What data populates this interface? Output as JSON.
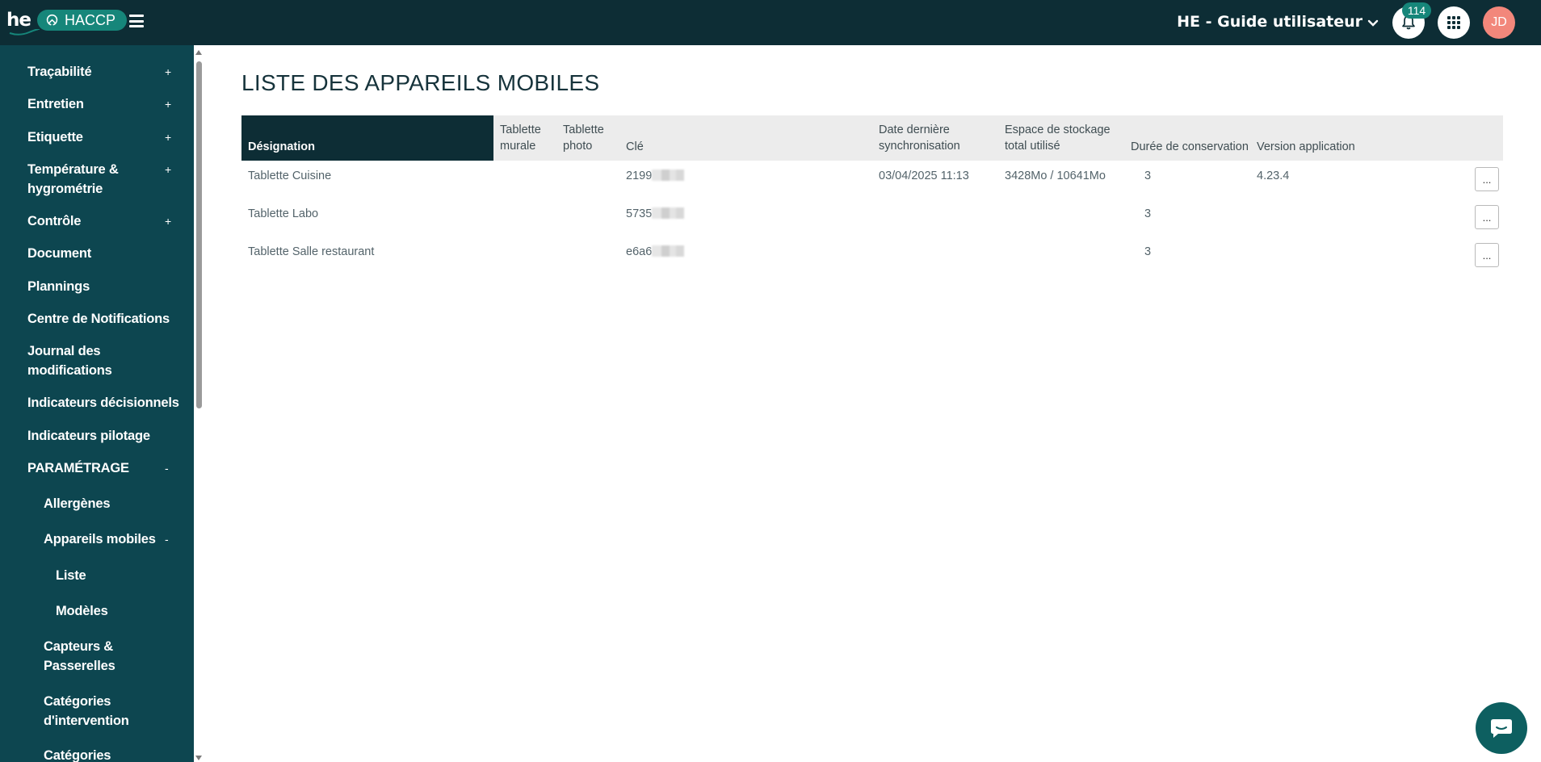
{
  "header": {
    "logo_text": "he",
    "app_name": "HACCP",
    "org_name": "HE - Guide utilisateur",
    "notification_count": "114",
    "avatar_initials": "JD"
  },
  "sidebar": {
    "items": [
      {
        "label": "Traçabilité",
        "toggle": "+",
        "level": 0
      },
      {
        "label": "Entretien",
        "toggle": "+",
        "level": 0
      },
      {
        "label": "Etiquette",
        "toggle": "+",
        "level": 0
      },
      {
        "label": "Température & hygrométrie",
        "toggle": "+",
        "level": 0
      },
      {
        "label": "Contrôle",
        "toggle": "+",
        "level": 0
      },
      {
        "label": "Document",
        "toggle": "",
        "level": 0
      },
      {
        "label": "Plannings",
        "toggle": "",
        "level": 0
      },
      {
        "label": "Centre de Notifications",
        "toggle": "",
        "level": 0
      },
      {
        "label": "Journal des modifications",
        "toggle": "",
        "level": 0
      },
      {
        "label": "Indicateurs décisionnels",
        "toggle": "",
        "level": 0
      },
      {
        "label": "Indicateurs pilotage",
        "toggle": "",
        "level": 0
      },
      {
        "label": "PARAMÉTRAGE",
        "toggle": "-",
        "level": 0
      },
      {
        "label": "Allergènes",
        "toggle": "",
        "level": 1
      },
      {
        "label": "Appareils mobiles",
        "toggle": "-",
        "level": 1
      },
      {
        "label": "Liste",
        "toggle": "",
        "level": 2
      },
      {
        "label": "Modèles",
        "toggle": "",
        "level": 2
      },
      {
        "label": "Capteurs & Passerelles",
        "toggle": "",
        "level": 1
      },
      {
        "label": "Catégories d'intervention",
        "toggle": "",
        "level": 1
      },
      {
        "label": "Catégories",
        "toggle": "",
        "level": 1
      }
    ]
  },
  "main": {
    "title": "LISTE DES APPAREILS MOBILES",
    "columns": {
      "designation": "Désignation",
      "tablette_murale_1": "Tablette",
      "tablette_murale_2": "murale",
      "tablette_photo_1": "Tablette",
      "tablette_photo_2": "photo",
      "cle": "Clé",
      "date_sync_1": "Date dernière",
      "date_sync_2": "synchronisation",
      "stockage_1": "Espace de stockage",
      "stockage_2": "total utilisé",
      "duree": "Durée de conservation",
      "version": "Version application"
    },
    "rows": [
      {
        "designation": "Tablette Cuisine",
        "cle": "2199",
        "date_sync": "03/04/2025 11:13",
        "stockage": "3428Mo / 10641Mo",
        "duree": "3",
        "version": "4.23.4",
        "action": "..."
      },
      {
        "designation": "Tablette Labo",
        "cle": "5735",
        "date_sync": "",
        "stockage": "",
        "duree": "3",
        "version": "",
        "action": "..."
      },
      {
        "designation": "Tablette Salle restaurant",
        "cle": "e6a6",
        "date_sync": "",
        "stockage": "",
        "duree": "3",
        "version": "",
        "action": "..."
      }
    ]
  },
  "icons": {
    "menu": "hamburger-icon",
    "bell": "bell-icon",
    "apps": "apps-grid-icon",
    "chat": "chat-icon",
    "dropdown": "chevron-down-icon"
  },
  "colors": {
    "topbar": "#0d2d35",
    "sidebar": "#0d4650",
    "accent": "#16867a",
    "avatar": "#f2877b",
    "chat": "#0d5f60"
  }
}
